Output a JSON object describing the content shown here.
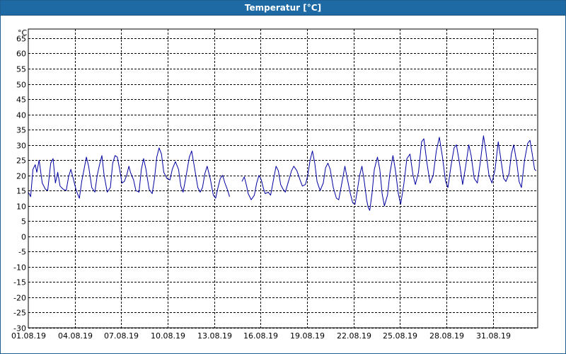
{
  "window": {
    "title": "Temperatur [°C]"
  },
  "colors": {
    "titlebar": "#1e6aa5",
    "line": "#0000a0",
    "grid": "#000000"
  },
  "chart_data": {
    "type": "line",
    "title": "Temperatur [°C]",
    "ylabel": "°C",
    "xlabel": "",
    "ylim": [
      -30,
      68
    ],
    "xlim": [
      "01.08.19",
      "01.09.19"
    ],
    "yticks": [
      65,
      60,
      55,
      50,
      45,
      40,
      35,
      30,
      25,
      20,
      15,
      10,
      5,
      0,
      -5,
      -10,
      -15,
      -20,
      -25,
      -30
    ],
    "xticks": [
      "01.08.19",
      "04.08.19",
      "07.08.19",
      "10.08.19",
      "13.08.19",
      "16.08.19",
      "19.08.19",
      "22.08.19",
      "25.08.19",
      "28.08.19",
      "31.08.19"
    ],
    "grid": true,
    "x_units": "date (day of August 2019, fractional)",
    "series": [
      {
        "values": [
          [
            1.0,
            14.5
          ],
          [
            1.15,
            13.0
          ],
          [
            1.3,
            22.0
          ],
          [
            1.45,
            23.5
          ],
          [
            1.55,
            21.0
          ],
          [
            1.7,
            25.0
          ],
          [
            1.9,
            17.5
          ],
          [
            2.1,
            15.5
          ],
          [
            2.25,
            15.0
          ],
          [
            2.45,
            24.0
          ],
          [
            2.6,
            25.5
          ],
          [
            2.75,
            17.5
          ],
          [
            2.9,
            21.0
          ],
          [
            3.05,
            16.5
          ],
          [
            3.25,
            15.5
          ],
          [
            3.45,
            15.0
          ],
          [
            3.6,
            19.5
          ],
          [
            3.75,
            22.0
          ],
          [
            3.9,
            19.0
          ],
          [
            4.1,
            15.0
          ],
          [
            4.3,
            12.5
          ],
          [
            4.45,
            18.0
          ],
          [
            4.6,
            22.0
          ],
          [
            4.75,
            26.0
          ],
          [
            4.9,
            23.0
          ],
          [
            5.1,
            16.0
          ],
          [
            5.3,
            14.5
          ],
          [
            5.45,
            20.0
          ],
          [
            5.6,
            23.5
          ],
          [
            5.75,
            26.5
          ],
          [
            5.9,
            20.0
          ],
          [
            6.1,
            14.5
          ],
          [
            6.3,
            16.0
          ],
          [
            6.45,
            24.0
          ],
          [
            6.6,
            26.5
          ],
          [
            6.75,
            26.0
          ],
          [
            6.9,
            22.0
          ],
          [
            7.05,
            17.5
          ],
          [
            7.2,
            18.0
          ],
          [
            7.35,
            20.0
          ],
          [
            7.5,
            23.0
          ],
          [
            7.6,
            21.0
          ],
          [
            7.8,
            18.5
          ],
          [
            7.95,
            15.0
          ],
          [
            8.15,
            14.5
          ],
          [
            8.3,
            22.0
          ],
          [
            8.45,
            25.5
          ],
          [
            8.6,
            22.0
          ],
          [
            8.8,
            15.5
          ],
          [
            9.0,
            14.0
          ],
          [
            9.15,
            19.0
          ],
          [
            9.3,
            26.0
          ],
          [
            9.45,
            29.0
          ],
          [
            9.6,
            27.0
          ],
          [
            9.75,
            21.0
          ],
          [
            9.95,
            19.0
          ],
          [
            10.15,
            18.5
          ],
          [
            10.3,
            22.0
          ],
          [
            10.5,
            24.5
          ],
          [
            10.7,
            22.0
          ],
          [
            10.85,
            16.5
          ],
          [
            11.0,
            14.5
          ],
          [
            11.2,
            20.0
          ],
          [
            11.4,
            26.0
          ],
          [
            11.55,
            28.0
          ],
          [
            11.75,
            22.0
          ],
          [
            11.95,
            16.0
          ],
          [
            12.1,
            14.5
          ],
          [
            12.25,
            16.0
          ],
          [
            12.4,
            20.5
          ],
          [
            12.55,
            23.0
          ],
          [
            12.75,
            19.0
          ],
          [
            12.95,
            13.5
          ],
          [
            13.1,
            12.5
          ],
          [
            13.25,
            16.0
          ],
          [
            13.4,
            19.0
          ],
          [
            13.55,
            20.0
          ],
          [
            13.7,
            17.5
          ],
          [
            13.85,
            15.5
          ],
          [
            14.0,
            13.0
          ],
          null,
          [
            14.8,
            18.0
          ],
          [
            14.95,
            19.5
          ],
          [
            15.1,
            16.5
          ],
          [
            15.2,
            14.0
          ],
          [
            15.4,
            12.0
          ],
          [
            15.6,
            13.5
          ],
          [
            15.75,
            17.5
          ],
          [
            15.9,
            20.0
          ],
          [
            16.05,
            18.5
          ],
          [
            16.2,
            15.5
          ],
          [
            16.3,
            14.0
          ],
          [
            16.5,
            14.5
          ],
          [
            16.65,
            13.5
          ],
          [
            16.85,
            19.0
          ],
          [
            17.0,
            23.0
          ],
          [
            17.15,
            21.5
          ],
          [
            17.3,
            17.0
          ],
          [
            17.45,
            15.5
          ],
          [
            17.6,
            14.5
          ],
          [
            17.8,
            18.0
          ],
          [
            18.0,
            21.5
          ],
          [
            18.15,
            23.0
          ],
          [
            18.35,
            21.5
          ],
          [
            18.55,
            18.5
          ],
          [
            18.7,
            16.5
          ],
          [
            18.9,
            17.0
          ],
          [
            19.05,
            20.0
          ],
          [
            19.2,
            25.0
          ],
          [
            19.35,
            28.0
          ],
          [
            19.5,
            24.0
          ],
          [
            19.65,
            18.0
          ],
          [
            19.85,
            15.0
          ],
          [
            20.05,
            17.5
          ],
          [
            20.2,
            22.5
          ],
          [
            20.35,
            24.0
          ],
          [
            20.5,
            22.0
          ],
          [
            20.7,
            16.0
          ],
          [
            20.9,
            12.5
          ],
          [
            21.05,
            12.0
          ],
          [
            21.25,
            17.5
          ],
          [
            21.45,
            23.0
          ],
          [
            21.6,
            19.0
          ],
          [
            21.8,
            14.0
          ],
          [
            21.95,
            11.0
          ],
          [
            22.1,
            10.5
          ],
          [
            22.25,
            15.0
          ],
          [
            22.4,
            20.0
          ],
          [
            22.55,
            23.0
          ],
          [
            22.7,
            18.0
          ],
          [
            22.85,
            12.0
          ],
          [
            22.95,
            9.5
          ],
          [
            23.05,
            8.5
          ],
          [
            23.2,
            14.0
          ],
          [
            23.35,
            22.0
          ],
          [
            23.55,
            26.0
          ],
          [
            23.7,
            22.0
          ],
          [
            23.85,
            14.0
          ],
          [
            24.0,
            10.0
          ],
          [
            24.2,
            13.5
          ],
          [
            24.35,
            20.5
          ],
          [
            24.55,
            26.5
          ],
          [
            24.7,
            22.0
          ],
          [
            24.9,
            14.0
          ],
          [
            25.05,
            10.5
          ],
          [
            25.25,
            17.0
          ],
          [
            25.45,
            25.5
          ],
          [
            25.65,
            27.0
          ],
          [
            25.85,
            20.0
          ],
          [
            26.0,
            17.0
          ],
          [
            26.2,
            21.0
          ],
          [
            26.4,
            31.0
          ],
          [
            26.55,
            32.0
          ],
          [
            26.75,
            24.0
          ],
          [
            26.95,
            17.5
          ],
          [
            27.15,
            20.0
          ],
          [
            27.35,
            28.0
          ],
          [
            27.55,
            32.5
          ],
          [
            27.75,
            26.0
          ],
          [
            27.95,
            18.0
          ],
          [
            28.1,
            16.0
          ],
          [
            28.3,
            23.0
          ],
          [
            28.5,
            29.0
          ],
          [
            28.65,
            30.0
          ],
          [
            28.85,
            24.0
          ],
          [
            29.05,
            17.0
          ],
          [
            29.25,
            23.0
          ],
          [
            29.45,
            30.0
          ],
          [
            29.6,
            26.5
          ],
          [
            29.8,
            19.0
          ],
          [
            30.0,
            17.5
          ],
          [
            30.2,
            24.5
          ],
          [
            30.4,
            33.0
          ],
          [
            30.55,
            28.0
          ],
          [
            30.75,
            20.0
          ],
          [
            30.95,
            17.5
          ],
          [
            31.15,
            22.0
          ],
          [
            31.35,
            31.0
          ],
          [
            31.5,
            26.0
          ],
          [
            31.7,
            19.0
          ],
          [
            31.85,
            18.0
          ],
          [
            32.05,
            20.5
          ],
          [
            32.2,
            27.0
          ],
          [
            32.35,
            30.0
          ],
          [
            32.55,
            24.0
          ],
          [
            32.7,
            18.0
          ],
          [
            32.85,
            16.0
          ],
          [
            33.05,
            25.0
          ],
          [
            33.25,
            30.5
          ],
          [
            33.4,
            31.5
          ],
          [
            33.55,
            27.0
          ],
          [
            33.7,
            22.0
          ],
          [
            33.8,
            21.5
          ]
        ]
      }
    ]
  }
}
